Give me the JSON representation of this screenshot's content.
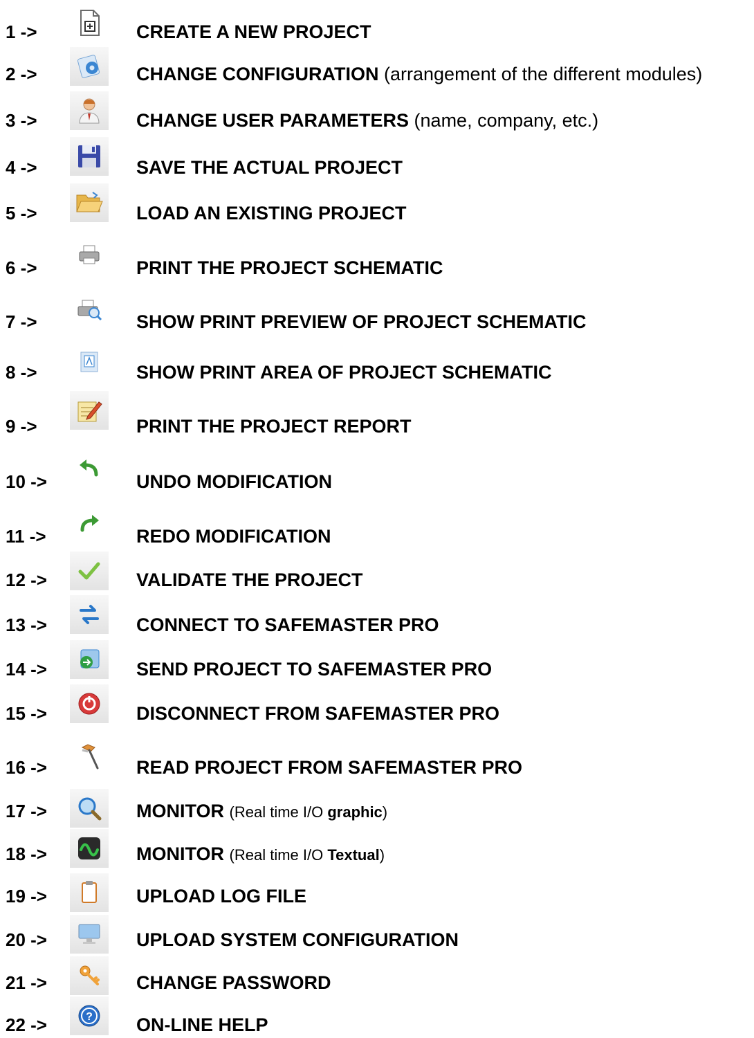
{
  "items": [
    {
      "number": "1 ->",
      "icon": "new-project-icon",
      "title": "CREATE A NEW PROJECT"
    },
    {
      "number": "2 ->",
      "icon": "configuration-icon",
      "title": "CHANGE CONFIGURATION",
      "note": "(arrangement of the different modules)"
    },
    {
      "number": "3 ->",
      "icon": "user-icon",
      "title": "CHANGE USER PARAMETERS",
      "note": "(name, company, etc.)"
    },
    {
      "number": "4 ->",
      "icon": "save-icon",
      "title": "SAVE THE ACTUAL PROJECT"
    },
    {
      "number": "5 ->",
      "icon": "open-folder-icon",
      "title": "LOAD AN EXISTING PROJECT"
    },
    {
      "number": "6 ->",
      "icon": "printer-icon",
      "title": "PRINT THE PROJECT SCHEMATIC"
    },
    {
      "number": "7 ->",
      "icon": "print-preview-icon",
      "title": "SHOW PRINT PREVIEW OF PROJECT SCHEMATIC"
    },
    {
      "number": "8 ->",
      "icon": "print-area-icon",
      "title": "SHOW PRINT AREA OF PROJECT SCHEMATIC"
    },
    {
      "number": "9 ->",
      "icon": "report-icon",
      "title": "PRINT THE PROJECT REPORT"
    },
    {
      "number": "10 ->",
      "icon": "undo-icon",
      "title": "UNDO MODIFICATION"
    },
    {
      "number": "11 ->",
      "icon": "redo-icon",
      "title": "REDO MODIFICATION"
    },
    {
      "number": "12 ->",
      "icon": "validate-check-icon",
      "title": "VALIDATE THE PROJECT"
    },
    {
      "number": "13 ->",
      "icon": "connect-icon",
      "title": "CONNECT TO SAFEMASTER PRO"
    },
    {
      "number": "14 ->",
      "icon": "send-project-icon",
      "title": "SEND PROJECT TO SAFEMASTER PRO"
    },
    {
      "number": "15 ->",
      "icon": "disconnect-icon",
      "title": "DISCONNECT FROM SAFEMASTER PRO"
    },
    {
      "number": "16 ->",
      "icon": "read-project-icon",
      "title": "READ PROJECT FROM SAFEMASTER PRO"
    },
    {
      "number": "17 ->",
      "icon": "monitor-magnifier-icon",
      "title": "MONITOR",
      "note_prefix": "(Real time I/O ",
      "note_bold": "graphic",
      "note_suffix": ")"
    },
    {
      "number": "18 ->",
      "icon": "monitor-wave-icon",
      "title": "MONITOR",
      "note_prefix": "(Real time I/O ",
      "note_bold": "Textual",
      "note_suffix": ")"
    },
    {
      "number": "19 ->",
      "icon": "clipboard-icon",
      "title": "UPLOAD LOG FILE"
    },
    {
      "number": "20 ->",
      "icon": "computer-screen-icon",
      "title": "UPLOAD SYSTEM CONFIGURATION"
    },
    {
      "number": "21 ->",
      "icon": "keys-icon",
      "title": "CHANGE PASSWORD"
    },
    {
      "number": "22 ->",
      "icon": "help-icon",
      "title": "ON-LINE HELP"
    }
  ]
}
